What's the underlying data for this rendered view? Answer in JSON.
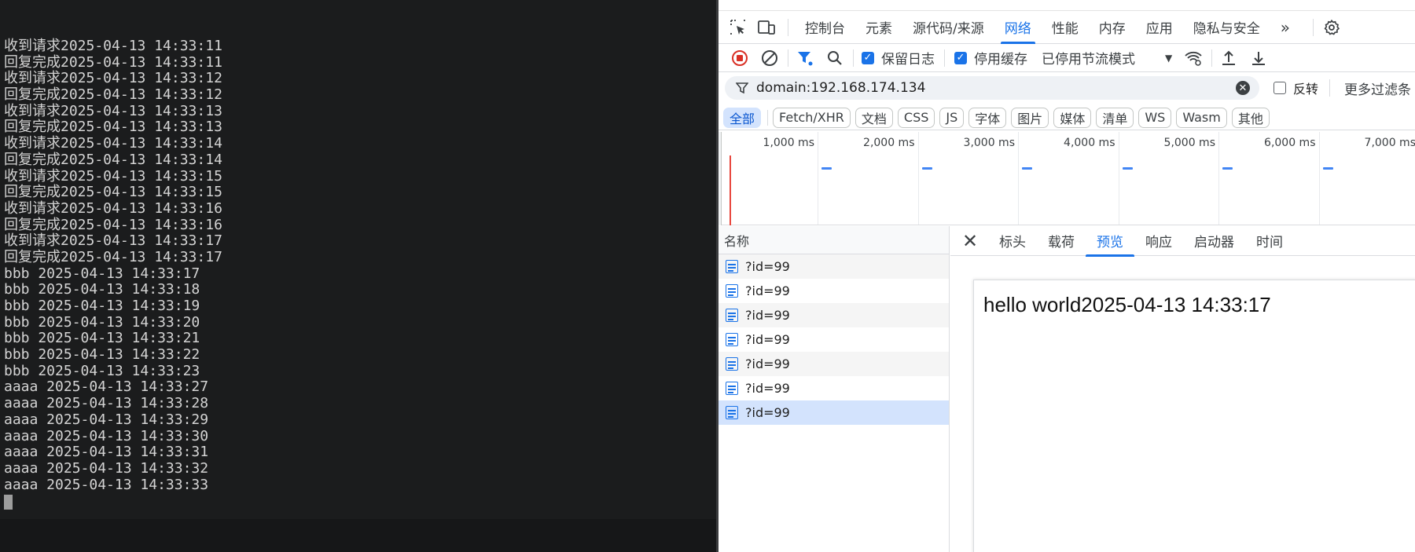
{
  "terminal": {
    "lines": [
      "收到请求2025-04-13 14:33:11",
      "回复完成2025-04-13 14:33:11",
      "收到请求2025-04-13 14:33:12",
      "回复完成2025-04-13 14:33:12",
      "收到请求2025-04-13 14:33:13",
      "回复完成2025-04-13 14:33:13",
      "收到请求2025-04-13 14:33:14",
      "回复完成2025-04-13 14:33:14",
      "收到请求2025-04-13 14:33:15",
      "回复完成2025-04-13 14:33:15",
      "收到请求2025-04-13 14:33:16",
      "回复完成2025-04-13 14:33:16",
      "收到请求2025-04-13 14:33:17",
      "回复完成2025-04-13 14:33:17",
      "bbb 2025-04-13 14:33:17",
      "bbb 2025-04-13 14:33:18",
      "bbb 2025-04-13 14:33:19",
      "bbb 2025-04-13 14:33:20",
      "bbb 2025-04-13 14:33:21",
      "bbb 2025-04-13 14:33:22",
      "bbb 2025-04-13 14:33:23",
      "aaaa 2025-04-13 14:33:27",
      "aaaa 2025-04-13 14:33:28",
      "aaaa 2025-04-13 14:33:29",
      "aaaa 2025-04-13 14:33:30",
      "aaaa 2025-04-13 14:33:31",
      "aaaa 2025-04-13 14:33:32",
      "aaaa 2025-04-13 14:33:33"
    ]
  },
  "devtools": {
    "main_tabs": [
      {
        "label": "控制台",
        "active": false
      },
      {
        "label": "元素",
        "active": false
      },
      {
        "label": "源代码/来源",
        "active": false
      },
      {
        "label": "网络",
        "active": true
      },
      {
        "label": "性能",
        "active": false
      },
      {
        "label": "内存",
        "active": false
      },
      {
        "label": "应用",
        "active": false
      },
      {
        "label": "隐私与安全",
        "active": false
      }
    ],
    "toolbar": {
      "preserve_log": "保留日志",
      "disable_cache": "停用缓存",
      "throttling": "已停用节流模式"
    },
    "filter": {
      "value": "domain:192.168.174.134",
      "invert_label": "反转",
      "more_filters": "更多过滤条"
    },
    "type_filters": [
      {
        "label": "全部",
        "active": true
      },
      {
        "label": "Fetch/XHR",
        "active": false
      },
      {
        "label": "文档",
        "active": false
      },
      {
        "label": "CSS",
        "active": false
      },
      {
        "label": "JS",
        "active": false
      },
      {
        "label": "字体",
        "active": false
      },
      {
        "label": "图片",
        "active": false
      },
      {
        "label": "媒体",
        "active": false
      },
      {
        "label": "清单",
        "active": false
      },
      {
        "label": "WS",
        "active": false
      },
      {
        "label": "Wasm",
        "active": false
      },
      {
        "label": "其他",
        "active": false
      }
    ],
    "timeline_ticks": [
      "1,000 ms",
      "2,000 ms",
      "3,000 ms",
      "4,000 ms",
      "5,000 ms",
      "6,000 ms",
      "7,000 ms"
    ],
    "list_header": "名称",
    "requests": [
      {
        "name": "?id=99",
        "selected": false
      },
      {
        "name": "?id=99",
        "selected": false
      },
      {
        "name": "?id=99",
        "selected": false
      },
      {
        "name": "?id=99",
        "selected": false
      },
      {
        "name": "?id=99",
        "selected": false
      },
      {
        "name": "?id=99",
        "selected": false
      },
      {
        "name": "?id=99",
        "selected": true
      }
    ],
    "detail_tabs": [
      {
        "label": "标头",
        "active": false
      },
      {
        "label": "载荷",
        "active": false
      },
      {
        "label": "预览",
        "active": true
      },
      {
        "label": "响应",
        "active": false
      },
      {
        "label": "启动器",
        "active": false
      },
      {
        "label": "时间",
        "active": false
      }
    ],
    "preview_text": "hello world2025-04-13 14:33:17"
  }
}
